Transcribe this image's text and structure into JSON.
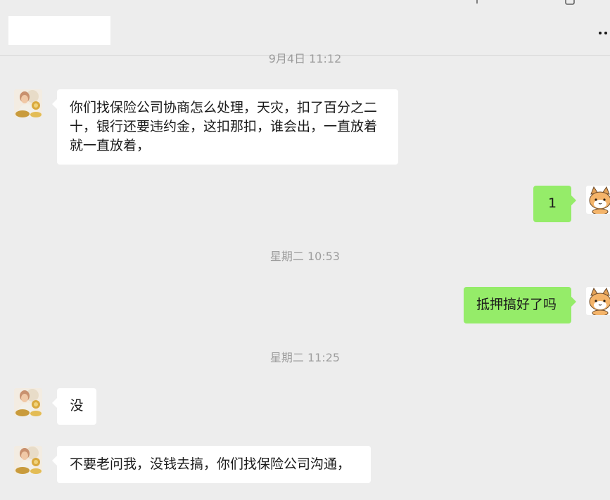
{
  "header": {
    "menu_icon": "more-dots-icon"
  },
  "messages": [
    {
      "type": "timestamp",
      "text": "9月4日 11:12"
    },
    {
      "type": "incoming",
      "text": "你们找保险公司协商怎么处理，天灾，扣了百分之二十，银行还要违约金，这扣那扣，谁会出，一直放着就一直放着，",
      "avatar": "contact-avatar"
    },
    {
      "type": "outgoing",
      "text": "1",
      "avatar": "cat-avatar"
    },
    {
      "type": "timestamp",
      "text": "星期二 10:53"
    },
    {
      "type": "outgoing",
      "text": "抵押搞好了吗",
      "avatar": "cat-avatar"
    },
    {
      "type": "timestamp",
      "text": "星期二 11:25"
    },
    {
      "type": "incoming",
      "text": "没",
      "avatar": "contact-avatar"
    },
    {
      "type": "incoming",
      "text": "不要老问我，没钱去搞，你们找保险公司沟通，",
      "avatar": "contact-avatar"
    }
  ],
  "colors": {
    "background": "#ededed",
    "incoming_bubble": "#ffffff",
    "outgoing_bubble": "#95ec69",
    "timestamp": "#9d9d9d"
  }
}
